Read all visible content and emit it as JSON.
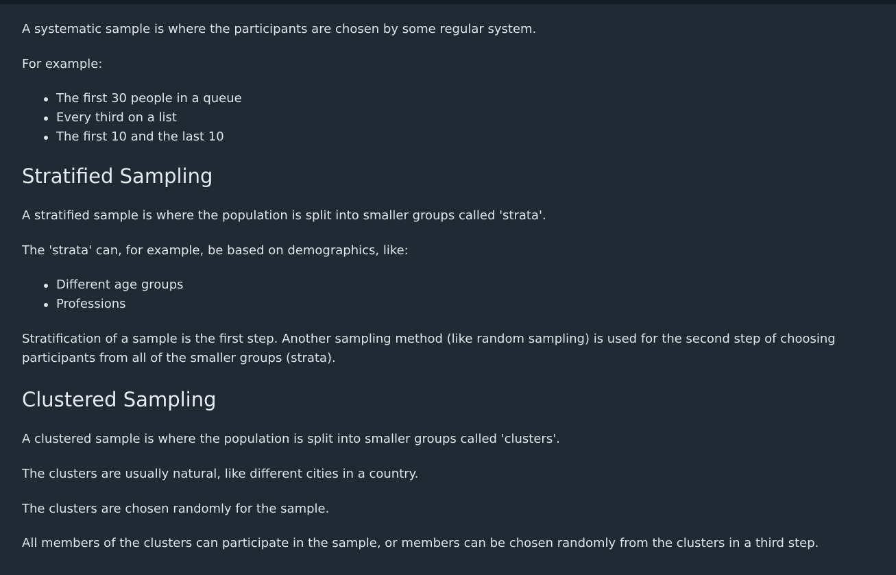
{
  "systematic": {
    "intro": "A systematic sample is where the participants are chosen by some regular system.",
    "example_lead": "For example:",
    "examples": [
      "The first 30 people in a queue",
      "Every third on a list",
      "The first 10 and the last 10"
    ]
  },
  "stratified": {
    "heading": "Stratified Sampling",
    "p1": "A stratified sample is where the population is split into smaller groups called 'strata'.",
    "p2": "The 'strata' can, for example, be based on demographics, like:",
    "items": [
      "Different age groups",
      "Professions"
    ],
    "p3": "Stratification of a sample is the first step. Another sampling method (like random sampling) is used for the second step of choosing participants from all of the smaller groups (strata)."
  },
  "clustered": {
    "heading": "Clustered Sampling",
    "p1": "A clustered sample is where the population is split into smaller groups called 'clusters'.",
    "p2": "The clusters are usually natural, like different cities in a country.",
    "p3": "The clusters are chosen randomly for the sample.",
    "p4": "All members of the clusters can participate in the sample, or members can be chosen randomly from the clusters in a third step."
  }
}
